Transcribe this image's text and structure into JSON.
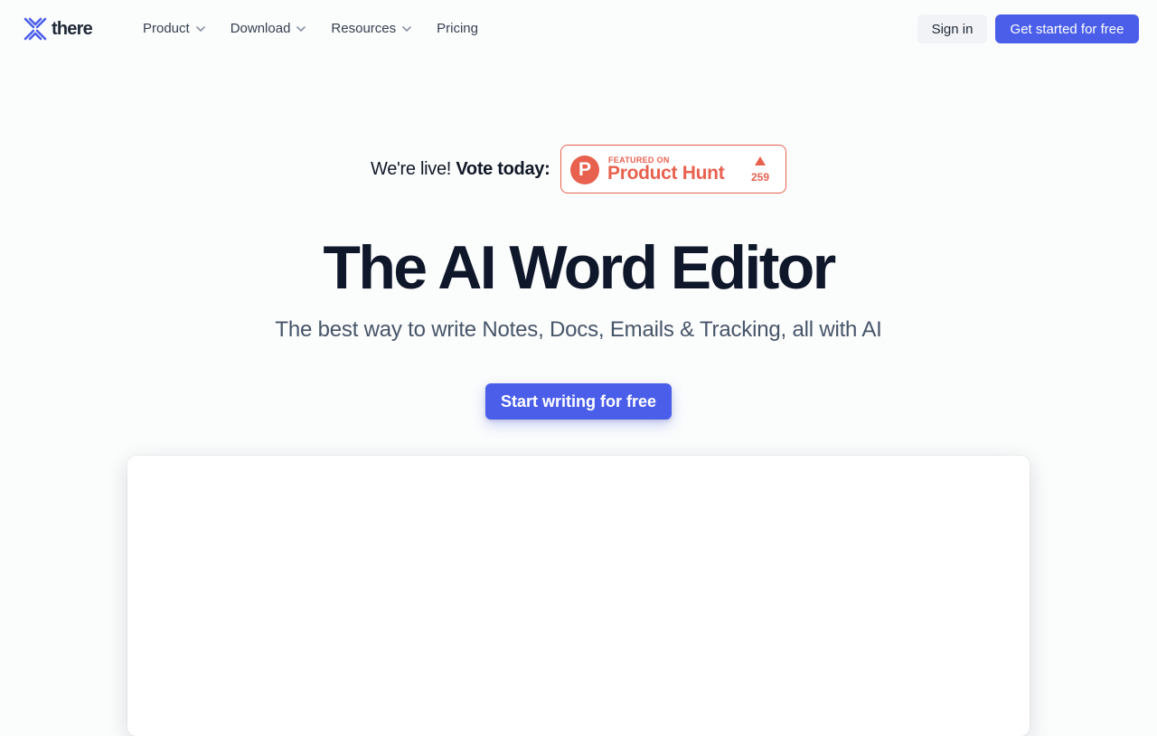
{
  "brand": {
    "name": "there",
    "accent_color": "#4a5eea",
    "logo_icon": "x-logo-icon"
  },
  "nav": {
    "items": [
      {
        "label": "Product",
        "has_dropdown": true
      },
      {
        "label": "Download",
        "has_dropdown": true
      },
      {
        "label": "Resources",
        "has_dropdown": true
      },
      {
        "label": "Pricing",
        "has_dropdown": false
      }
    ]
  },
  "header_actions": {
    "signin_label": "Sign in",
    "cta_label": "Get started for free"
  },
  "announcement": {
    "prefix": "We're live!",
    "emphasis": "Vote today:",
    "badge": {
      "featured_label": "FEATURED ON",
      "name": "Product Hunt",
      "logo_letter": "P",
      "votes": "259",
      "color": "#e8614f"
    }
  },
  "hero": {
    "title": "The AI Word Editor",
    "subtitle": "The best way to write Notes, Docs, Emails & Tracking, all with AI",
    "cta_label": "Start writing for free"
  }
}
